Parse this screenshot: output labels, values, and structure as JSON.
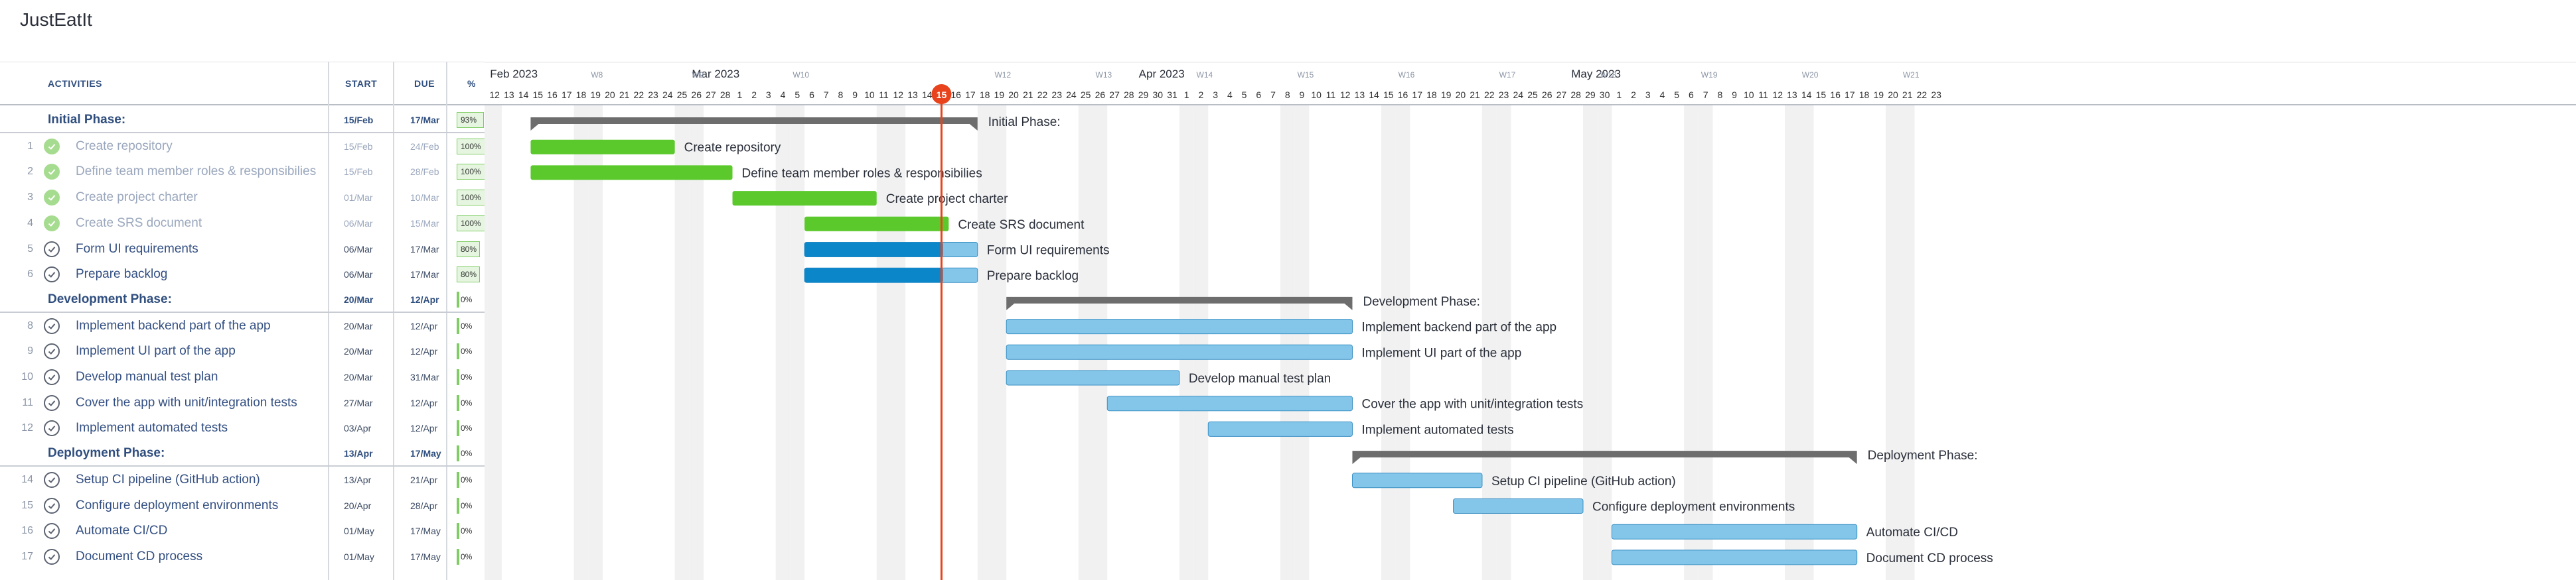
{
  "app": {
    "title": "JustEatIt"
  },
  "columns": {
    "activities": "ACTIVITIES",
    "start": "START",
    "due": "DUE",
    "pct": "%"
  },
  "timeline": {
    "months": [
      {
        "label": "Feb 2023",
        "day_index": -1
      },
      {
        "label": "Mar 2023",
        "day_index": 13
      },
      {
        "label": "Apr 2023",
        "day_index": 44
      },
      {
        "label": "May 2023",
        "day_index": 74
      }
    ],
    "weeks": [
      {
        "label": "W8",
        "day_index": 6
      },
      {
        "label": "W9",
        "day_index": 13
      },
      {
        "label": "W10",
        "day_index": 20
      },
      {
        "label": "W12",
        "day_index": 34
      },
      {
        "label": "W13",
        "day_index": 41
      },
      {
        "label": "W14",
        "day_index": 48
      },
      {
        "label": "W15",
        "day_index": 55
      },
      {
        "label": "W16",
        "day_index": 62
      },
      {
        "label": "W17",
        "day_index": 69
      },
      {
        "label": "W18",
        "day_index": 76
      },
      {
        "label": "W19",
        "day_index": 83
      },
      {
        "label": "W20",
        "day_index": 90
      },
      {
        "label": "W21",
        "day_index": 97
      }
    ],
    "start_date": "2023-02-13",
    "days_shown": 100,
    "today_label": "15",
    "today_date": "2023-03-15",
    "colors": {
      "phase_bar": "#6d6d6d",
      "done_bar": "#5bc92c",
      "progress_bar": "#0a86c9",
      "planned_bar": "#83c6ea",
      "today_line": "#e8431c",
      "weekend": "#f1f1f1"
    }
  },
  "rows": [
    {
      "type": "phase",
      "name": "Initial Phase:",
      "start": "15/Feb",
      "due": "17/Mar",
      "pct": "93%",
      "pct_value": 93,
      "start_date": "2023-02-15",
      "end_date": "2023-03-17"
    },
    {
      "type": "task",
      "num": "1",
      "name": "Create repository",
      "start": "15/Feb",
      "due": "24/Feb",
      "pct": "100%",
      "pct_value": 100,
      "done": true,
      "start_date": "2023-02-15",
      "end_date": "2023-02-24"
    },
    {
      "type": "task",
      "num": "2",
      "name": "Define team member roles & responsibilies",
      "start": "15/Feb",
      "due": "28/Feb",
      "pct": "100%",
      "pct_value": 100,
      "done": true,
      "start_date": "2023-02-15",
      "end_date": "2023-02-28"
    },
    {
      "type": "task",
      "num": "3",
      "name": "Create project charter",
      "start": "01/Mar",
      "due": "10/Mar",
      "pct": "100%",
      "pct_value": 100,
      "done": true,
      "start_date": "2023-03-01",
      "end_date": "2023-03-10"
    },
    {
      "type": "task",
      "num": "4",
      "name": "Create SRS document",
      "start": "06/Mar",
      "due": "15/Mar",
      "pct": "100%",
      "pct_value": 100,
      "done": true,
      "start_date": "2023-03-06",
      "end_date": "2023-03-15"
    },
    {
      "type": "task",
      "num": "5",
      "name": "Form UI requirements",
      "start": "06/Mar",
      "due": "17/Mar",
      "pct": "80%",
      "pct_value": 80,
      "done": false,
      "start_date": "2023-03-06",
      "end_date": "2023-03-17"
    },
    {
      "type": "task",
      "num": "6",
      "name": "Prepare backlog",
      "start": "06/Mar",
      "due": "17/Mar",
      "pct": "80%",
      "pct_value": 80,
      "done": false,
      "start_date": "2023-03-06",
      "end_date": "2023-03-17"
    },
    {
      "type": "phase",
      "name": "Development Phase:",
      "start": "20/Mar",
      "due": "12/Apr",
      "pct": "0%",
      "pct_value": 0,
      "start_date": "2023-03-20",
      "end_date": "2023-04-12"
    },
    {
      "type": "task",
      "num": "8",
      "name": "Implement backend part of the app",
      "start": "20/Mar",
      "due": "12/Apr",
      "pct": "0%",
      "pct_value": 0,
      "done": false,
      "start_date": "2023-03-20",
      "end_date": "2023-04-12"
    },
    {
      "type": "task",
      "num": "9",
      "name": "Implement UI part of the app",
      "start": "20/Mar",
      "due": "12/Apr",
      "pct": "0%",
      "pct_value": 0,
      "done": false,
      "start_date": "2023-03-20",
      "end_date": "2023-04-12"
    },
    {
      "type": "task",
      "num": "10",
      "name": "Develop manual test plan",
      "start": "20/Mar",
      "due": "31/Mar",
      "pct": "0%",
      "pct_value": 0,
      "done": false,
      "start_date": "2023-03-20",
      "end_date": "2023-03-31"
    },
    {
      "type": "task",
      "num": "11",
      "name": "Cover the app with unit/integration tests",
      "start": "27/Mar",
      "due": "12/Apr",
      "pct": "0%",
      "pct_value": 0,
      "done": false,
      "start_date": "2023-03-27",
      "end_date": "2023-04-12"
    },
    {
      "type": "task",
      "num": "12",
      "name": "Implement automated tests",
      "start": "03/Apr",
      "due": "12/Apr",
      "pct": "0%",
      "pct_value": 0,
      "done": false,
      "start_date": "2023-04-03",
      "end_date": "2023-04-12"
    },
    {
      "type": "phase",
      "name": "Deployment Phase:",
      "start": "13/Apr",
      "due": "17/May",
      "pct": "0%",
      "pct_value": 0,
      "start_date": "2023-04-13",
      "end_date": "2023-05-17"
    },
    {
      "type": "task",
      "num": "14",
      "name": "Setup CI pipeline (GitHub action)",
      "start": "13/Apr",
      "due": "21/Apr",
      "pct": "0%",
      "pct_value": 0,
      "done": false,
      "start_date": "2023-04-13",
      "end_date": "2023-04-21"
    },
    {
      "type": "task",
      "num": "15",
      "name": "Configure deployment environments",
      "start": "20/Apr",
      "due": "28/Apr",
      "pct": "0%",
      "pct_value": 0,
      "done": false,
      "start_date": "2023-04-20",
      "end_date": "2023-04-28"
    },
    {
      "type": "task",
      "num": "16",
      "name": "Automate CI/CD",
      "start": "01/May",
      "due": "17/May",
      "pct": "0%",
      "pct_value": 0,
      "done": false,
      "start_date": "2023-05-01",
      "end_date": "2023-05-17"
    },
    {
      "type": "task",
      "num": "17",
      "name": "Document CD process",
      "start": "01/May",
      "due": "17/May",
      "pct": "0%",
      "pct_value": 0,
      "done": false,
      "start_date": "2023-05-01",
      "end_date": "2023-05-17"
    }
  ]
}
